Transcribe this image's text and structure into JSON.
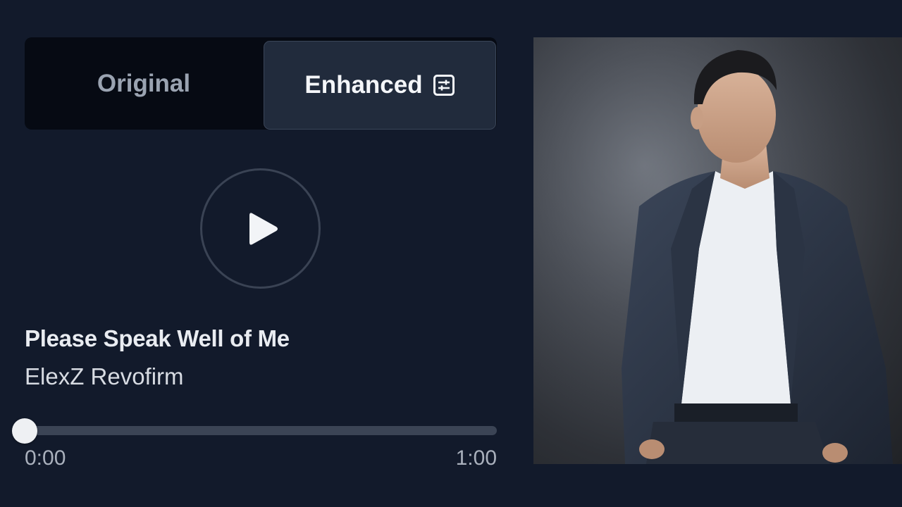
{
  "toggle": {
    "original_label": "Original",
    "enhanced_label": "Enhanced",
    "active": "Enhanced"
  },
  "player": {
    "play_icon": "play-icon",
    "track_title": "Please Speak Well of Me",
    "artist": "ElexZ Revofirm",
    "current_time": "0:00",
    "total_time": "1:00",
    "progress": 0
  },
  "cover": {
    "icon": "cover-art-image"
  },
  "colors": {
    "background": "#121a2b",
    "toggle_bg": "#060a13",
    "active_tab_bg": "#212b3c",
    "progress_track": "#3b4455",
    "thumb": "#eef0f3"
  }
}
